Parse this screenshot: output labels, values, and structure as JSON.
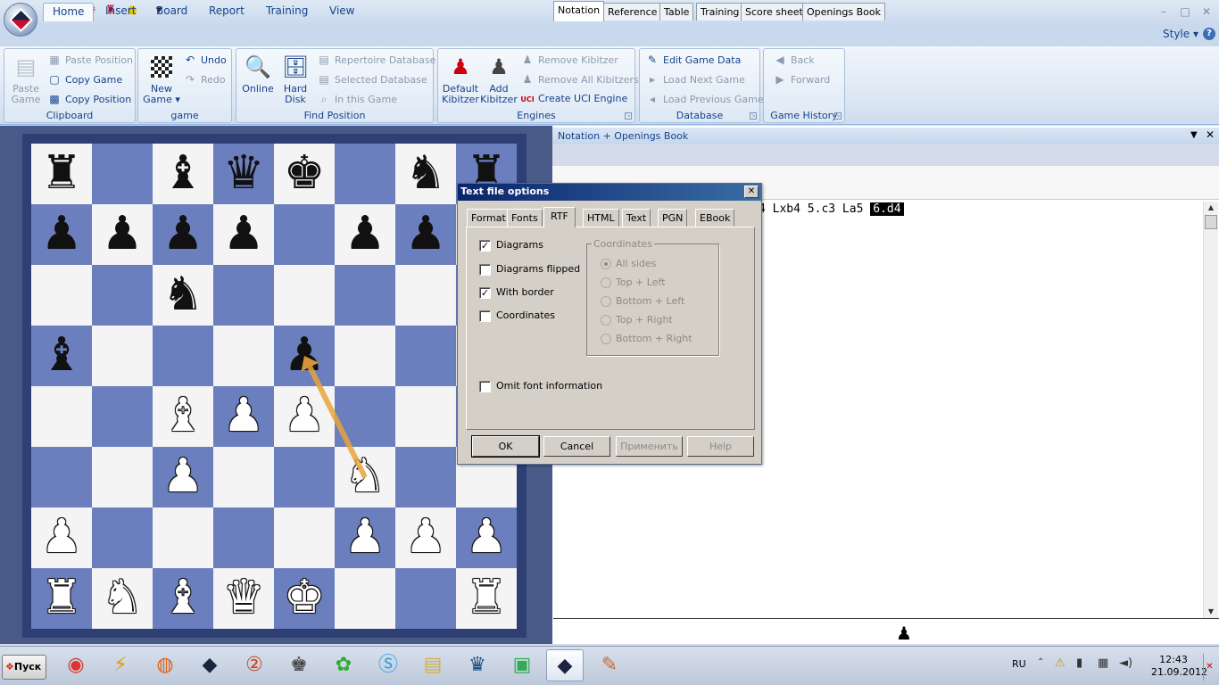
{
  "window": {
    "title": "Board",
    "style_label": "Style"
  },
  "tabs": [
    "Home",
    "Insert",
    "Board",
    "Report",
    "Training",
    "View"
  ],
  "ribbon": {
    "clipboard": {
      "label": "Clipboard",
      "paste_game": "Paste\nGame",
      "paste_position": "Paste Position",
      "copy_game": "Copy Game",
      "copy_position": "Copy Position"
    },
    "game": {
      "label": "game",
      "new_game": "New\nGame ▾",
      "undo": "Undo",
      "redo": "Redo"
    },
    "find": {
      "label": "Find Position",
      "online": "Online",
      "hard_disk": "Hard\nDisk",
      "repertoire": "Repertoire Database",
      "selected": "Selected Database",
      "in_game": "In this Game"
    },
    "engines": {
      "label": "Engines",
      "default_kibitzer": "Default\nKibitzer",
      "add_kibitzer": "Add\nKibitzer",
      "remove_kibitzer": "Remove Kibitzer",
      "remove_all": "Remove All Kibitzers",
      "create_uci": "Create UCI Engine"
    },
    "database": {
      "label": "Database",
      "edit_game_data": "Edit Game Data",
      "load_next": "Load Next Game",
      "load_prev": "Load Previous Game"
    },
    "history": {
      "label": "Game History",
      "back": "Back",
      "forward": "Forward"
    }
  },
  "notation_panel": {
    "title": "Notation + Openings Book",
    "tabs": [
      "Notation",
      "Reference",
      "Table",
      "Training",
      "Score sheet",
      "Openings Book"
    ],
    "moves_text": "4 Lxb4 5.c3 La5 ",
    "current_move": "6.d4"
  },
  "dialog": {
    "title": "Text file options",
    "tabs": [
      "Format",
      "Fonts",
      "RTF",
      "HTML",
      "Text",
      "PGN",
      "EBook"
    ],
    "active_tab": "RTF",
    "checkboxes": [
      {
        "label": "Diagrams",
        "checked": true
      },
      {
        "label": "Diagrams flipped",
        "checked": false
      },
      {
        "label": "With border",
        "checked": true
      },
      {
        "label": "Coordinates",
        "checked": false
      }
    ],
    "omit_font": {
      "label": "Omit font information",
      "checked": false
    },
    "coordinates_group": {
      "label": "Coordinates",
      "options": [
        "All sides",
        "Top + Left",
        "Bottom + Left",
        "Top + Right",
        "Bottom + Right"
      ],
      "selected": "All sides"
    },
    "buttons": {
      "ok": "OK",
      "cancel": "Cancel",
      "apply": "Применить",
      "help": "Help"
    }
  },
  "board": {
    "light_color": "#f4f4f4",
    "dark_color": "#6b7fbe",
    "rows": [
      [
        "r",
        "",
        "b",
        "q",
        "k",
        "",
        "n",
        "r"
      ],
      [
        "p",
        "p",
        "p",
        "p",
        "",
        "p",
        "p",
        ""
      ],
      [
        "",
        "",
        "n",
        "",
        "",
        "",
        "",
        ""
      ],
      [
        "b",
        "",
        "",
        "",
        "p",
        "",
        "",
        ""
      ],
      [
        "",
        "",
        "B",
        "P",
        "P",
        "",
        "",
        ""
      ],
      [
        "",
        "",
        "P",
        "",
        "",
        "N",
        "",
        ""
      ],
      [
        "P",
        "",
        "",
        "",
        "",
        "P",
        "P",
        "P"
      ],
      [
        "R",
        "N",
        "B",
        "Q",
        "K",
        "",
        "",
        "R"
      ]
    ],
    "arrow": {
      "from": "f3",
      "to": "e5",
      "color": "#e8a33a"
    }
  },
  "taskbar": {
    "start_label": "Пуск",
    "apps": [
      "chrome-icon",
      "winamp-icon",
      "firefox-icon",
      "fritz-icon",
      "app-icon",
      "chess-icon",
      "icq-icon",
      "skype-icon",
      "explorer-icon",
      "chessbase-icon",
      "monitor-icon",
      "fritz-active-icon",
      "paint-icon"
    ],
    "lang": "RU",
    "time": "12:43",
    "date": "21.09.2012"
  }
}
